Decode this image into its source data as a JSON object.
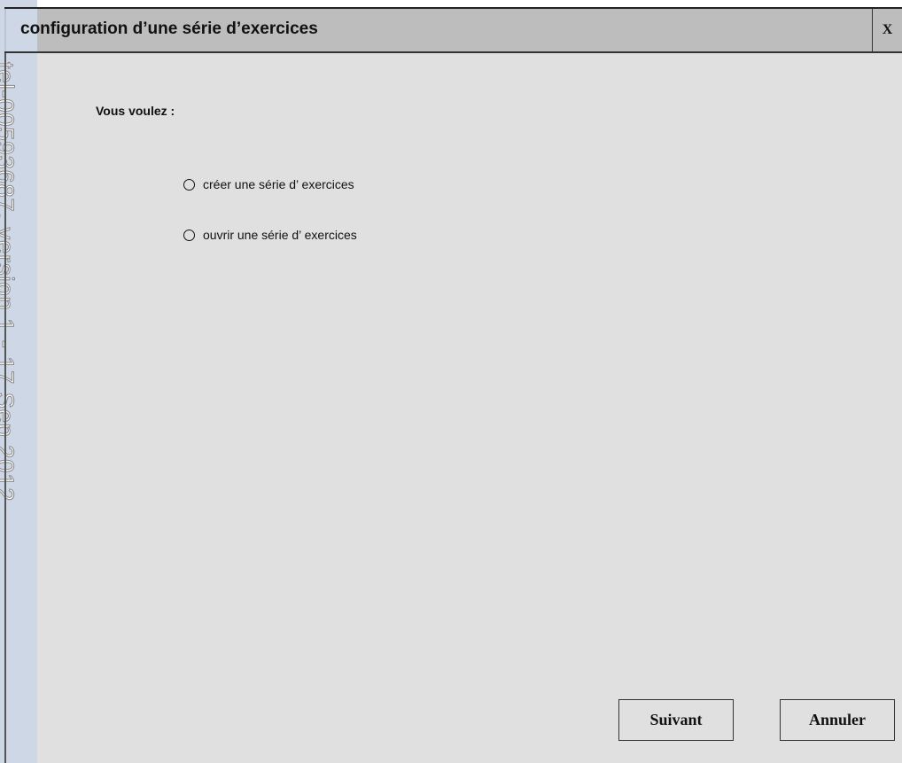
{
  "watermark": {
    "text": "tel-00593687, version 1 - 17 Sep 2012"
  },
  "window": {
    "title": "configuration d’une série d’exercices",
    "close_label": "X"
  },
  "form": {
    "question": "Vous voulez :",
    "options": [
      {
        "label": "créer une série d’ exercices",
        "selected": false
      },
      {
        "label": "ouvrir une série d’ exercices",
        "selected": false
      }
    ]
  },
  "buttons": {
    "next_label": "Suivant",
    "cancel_label": "Annuler"
  }
}
